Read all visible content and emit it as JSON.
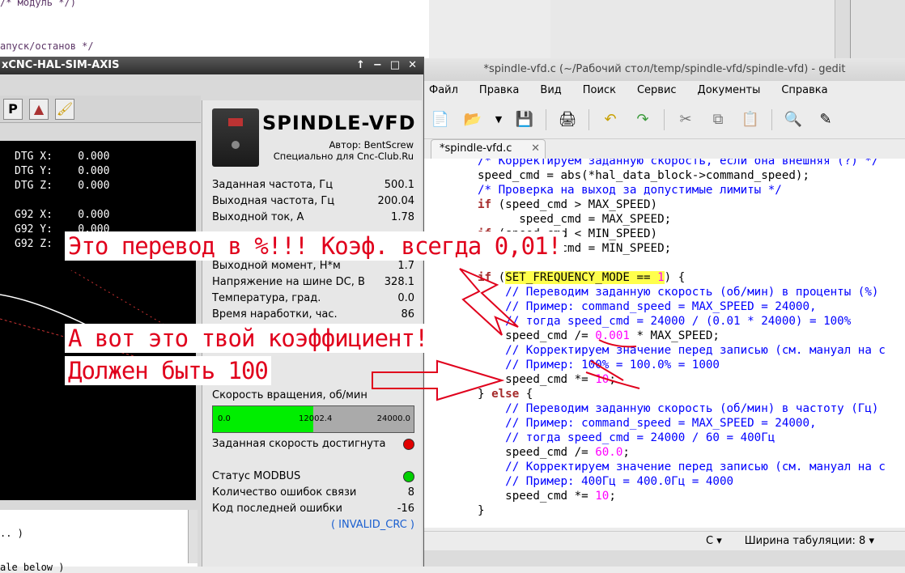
{
  "bg_top_lines": [
    "/* модуль */)",
    "апуск/останов */"
  ],
  "axis": {
    "title": "xCNC-HAL-SIM-AXIS",
    "title_btns": [
      "↑",
      "−",
      "□",
      "✕"
    ],
    "dro": [
      {
        "label": "DTG X:",
        "value": "0.000"
      },
      {
        "label": "DTG Y:",
        "value": "0.000"
      },
      {
        "label": "DTG Z:",
        "value": "0.000"
      },
      {
        "label": "G92 X:",
        "value": "0.000"
      },
      {
        "label": "G92 Y:",
        "value": "0.000"
      },
      {
        "label": "G92 Z:",
        "value": ""
      }
    ],
    "lower_lines": [
      ".. )",
      "ale below )"
    ]
  },
  "spindle": {
    "title": "SPINDLE-VFD",
    "author": "Автор: BentScrew",
    "site": "Специально для Cnc-Club.Ru",
    "params": [
      {
        "label": "Заданная частота, Гц",
        "value": "500.1"
      },
      {
        "label": "Выходная частота, Гц",
        "value": "200.04"
      },
      {
        "label": "Выходной ток, А",
        "value": "1.78"
      },
      {
        "label": "Выходной момент, Н*м",
        "value": "1.7"
      },
      {
        "label": "Напряжение на шине DC, В",
        "value": "328.1"
      },
      {
        "label": "Температура, град.",
        "value": "0.0"
      },
      {
        "label": "Время наработки, час.",
        "value": "86"
      }
    ],
    "speed_label": "Скорость вращения, об/мин",
    "speed_bar": {
      "min": "0.0",
      "current": "12002.4",
      "max": "24000.0",
      "fraction": 0.5
    },
    "reached_label": "Заданная скорость достигнута",
    "modbus_label": "Статус MODBUS",
    "err_count_label": "Количество ошибок связи",
    "err_count": "8",
    "last_err_label": "Код последней ошибки",
    "last_err": "-16",
    "last_err_name": "( INVALID_CRC )"
  },
  "gedit": {
    "title": "*spindle-vfd.c (~/Рабочий стол/temp/spindle-vfd/spindle-vfd) - gedit",
    "menu": [
      "Файл",
      "Правка",
      "Вид",
      "Поиск",
      "Сервис",
      "Документы",
      "Справка"
    ],
    "tab": "*spindle-vfd.c",
    "statusbar": {
      "lang": "C",
      "tab_width": "Ширина табуляции:  8"
    }
  },
  "notes": {
    "n1": "Это перевод в %!!! Коэф. всегда 0,01!",
    "n2": "А вот это твой коэффициент!",
    "n3": "Должен быть 100"
  },
  "colors": {
    "accent_red": "#e0001c",
    "led_red": "#e00000",
    "led_green": "#00d000",
    "bar_green": "#00ee00"
  }
}
